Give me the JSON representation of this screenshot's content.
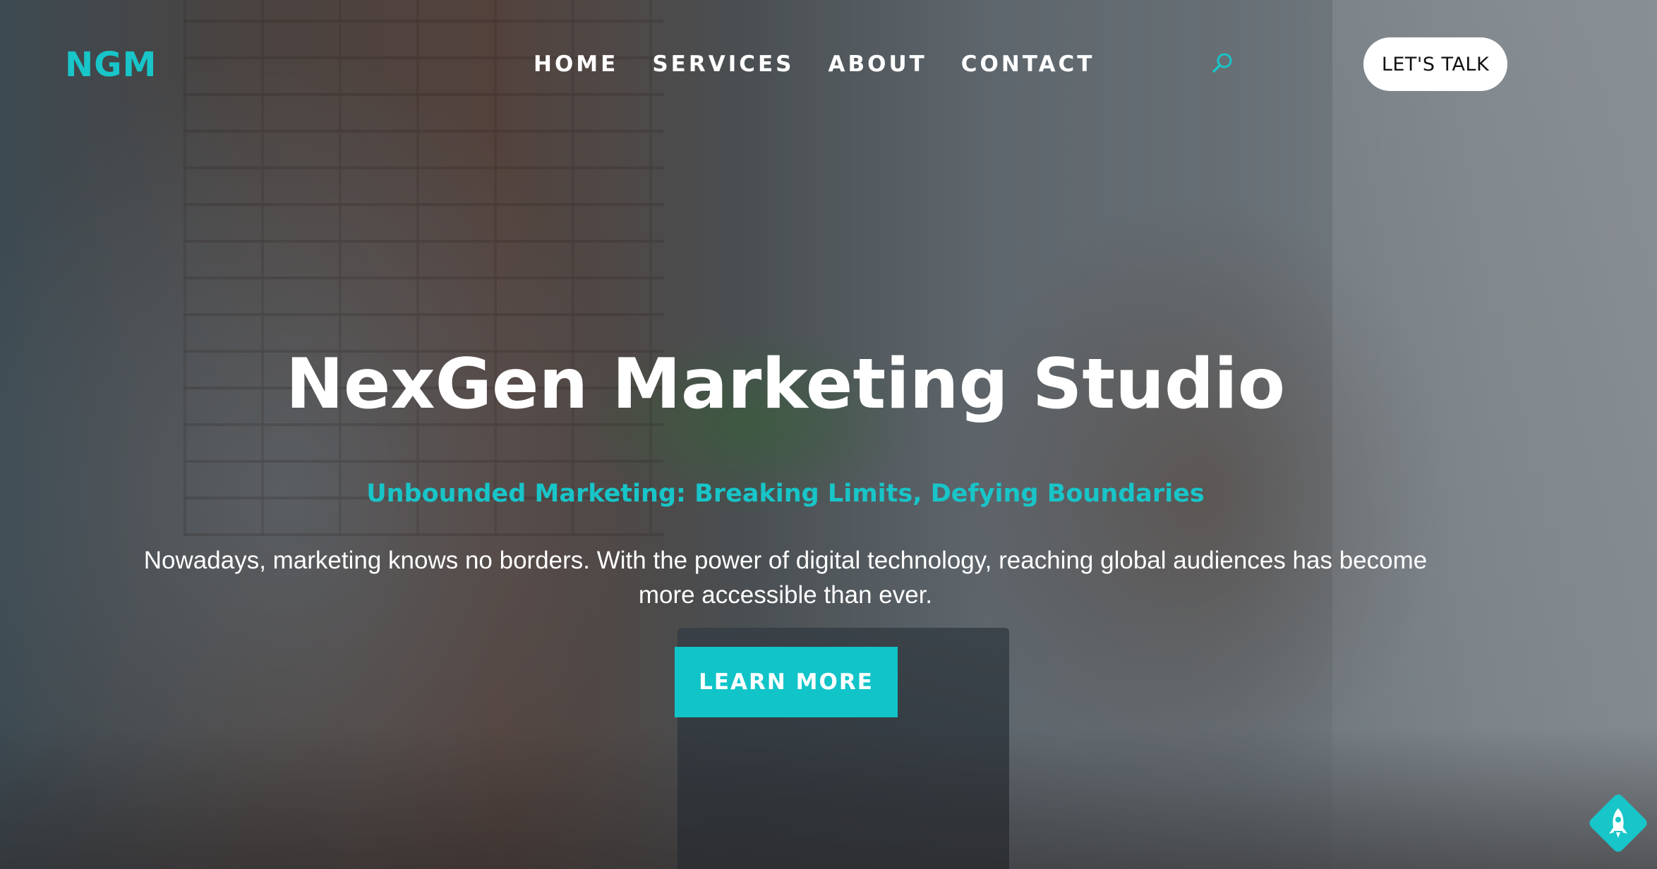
{
  "header": {
    "logo": "NGM",
    "nav": [
      "HOME",
      "SERVICES",
      "ABOUT",
      "CONTACT"
    ],
    "search_icon": "search-icon",
    "cta_label": "LET'S TALK"
  },
  "hero": {
    "title": "NexGen Marketing Studio",
    "subtitle": "Unbounded Marketing: Breaking Limits, Defying Boundaries",
    "body": "Nowadays, marketing knows no borders. With the power of digital technology, reaching global audiences has become more accessible than ever.",
    "button_label": "LEARN MORE"
  },
  "floating": {
    "icon": "rocket-icon"
  },
  "colors": {
    "accent": "#18c5c8",
    "button": "#11c4c8",
    "text_light": "#ffffff",
    "cta_bg": "#ffffff"
  }
}
